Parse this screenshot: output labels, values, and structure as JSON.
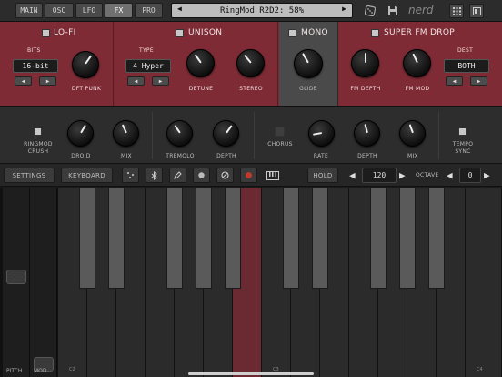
{
  "topbar": {
    "tabs": [
      {
        "label": "MAIN"
      },
      {
        "label": "OSC"
      },
      {
        "label": "LFO"
      },
      {
        "label": "FX"
      },
      {
        "label": "PRO"
      }
    ],
    "active_tab": "FX",
    "preset_name": "RingMod R2D2: 58%",
    "prev_arrow": "◀",
    "next_arrow": "▶",
    "logo": "nerd",
    "icons": [
      "dice-icon",
      "save-icon",
      "grid-icon",
      "window-icon"
    ]
  },
  "lofi": {
    "title": "LO-FI",
    "bits_label": "BITS",
    "bits_value": "16-bit",
    "dft_punk_label": "DFT PUNK"
  },
  "unison": {
    "title": "UNISON",
    "type_label": "TYPE",
    "type_value": "4 Hyper",
    "detune_label": "DETUNE",
    "stereo_label": "STEREO"
  },
  "mono": {
    "title": "MONO",
    "glide_label": "GLIDE"
  },
  "superfm": {
    "title": "SUPER FM DROP",
    "fm_depth_label": "FM DEPTH",
    "fm_mod_label": "FM MOD",
    "dest_label": "DEST",
    "dest_value": "BOTH"
  },
  "fx": {
    "ringmod_label": "RINGMOD\nCRUSH",
    "droid_label": "DROID",
    "mix1_label": "MIX",
    "tremolo_label": "TREMOLO",
    "depth1_label": "DEPTH",
    "chorus_label": "CHORUS",
    "rate_label": "RATE",
    "depth2_label": "DEPTH",
    "mix2_label": "MIX",
    "temposync_label": "TEMPO\nSYNC"
  },
  "toolbar": {
    "settings": "SETTINGS",
    "keyboard": "KEYBOARD",
    "hold": "HOLD",
    "tempo": "120",
    "octave_label": "OCTAVE",
    "octave_value": "0"
  },
  "keyboard": {
    "pitch_label": "PITCH",
    "mod_label": "MOD",
    "octave_labels": [
      "C2",
      "C3",
      "C4"
    ],
    "pressed_key_color": "#6b2a31"
  },
  "colors": {
    "red_panel": "#7e2b35",
    "mono_panel": "#4a4a4a",
    "accent_record": "#c0392b"
  }
}
